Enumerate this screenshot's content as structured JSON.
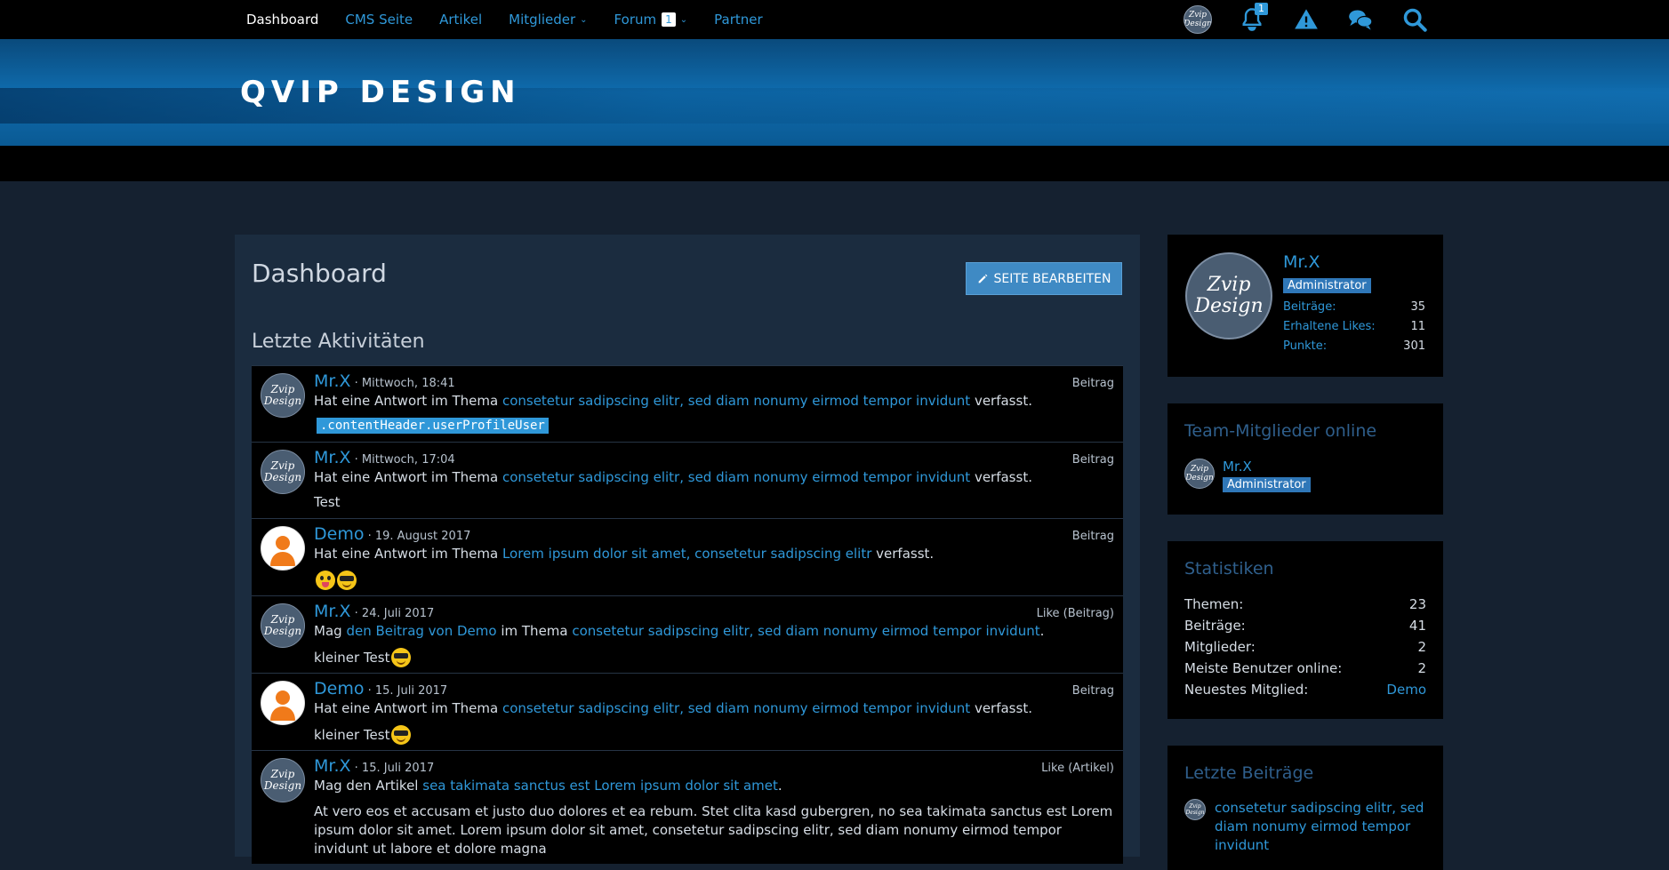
{
  "nav": {
    "items": [
      {
        "label": "Dashboard"
      },
      {
        "label": "CMS Seite"
      },
      {
        "label": "Artikel"
      },
      {
        "label": "Mitglieder"
      },
      {
        "label": "Forum",
        "badge": "1"
      },
      {
        "label": "Partner"
      }
    ],
    "notifications_count": "1"
  },
  "banner": {
    "logo": "QVIP DESIGN"
  },
  "avatar_text": "Zvip Design",
  "main": {
    "title": "Dashboard",
    "edit_button": "SEITE BEARBEITEN",
    "section_title": "Letzte Aktivitäten",
    "activities": [
      {
        "user": "Mr.X",
        "time": " · Mittwoch, 18:41",
        "type": "Beitrag",
        "desc_pre": "Hat eine Antwort im Thema ",
        "desc_link": "consetetur sadipscing elitr, sed diam nonumy eirmod tempor invidunt",
        "desc_post": " verfasst.",
        "body_code": ".contentHeader.userProfileUser"
      },
      {
        "user": "Mr.X",
        "time": " · Mittwoch, 17:04",
        "type": "Beitrag",
        "desc_pre": "Hat eine Antwort im Thema ",
        "desc_link": "consetetur sadipscing elitr, sed diam nonumy eirmod tempor invidunt",
        "desc_post": " verfasst.",
        "body": "Test"
      },
      {
        "user": "Demo",
        "time": " · 19. August 2017",
        "type": "Beitrag",
        "desc_pre": "Hat eine Antwort im Thema ",
        "desc_link": "Lorem ipsum dolor sit amet, consetetur sadipscing elitr",
        "desc_post": " verfasst."
      },
      {
        "user": "Mr.X",
        "time": " · 24. Juli 2017",
        "type": "Like (Beitrag)",
        "desc_pre": "Mag ",
        "desc_link1": "den Beitrag von Demo",
        "desc_mid": " im Thema ",
        "desc_link": "consetetur sadipscing elitr, sed diam nonumy eirmod tempor invidunt",
        "desc_post": ".",
        "body": "kleiner Test"
      },
      {
        "user": "Demo",
        "time": " · 15. Juli 2017",
        "type": "Beitrag",
        "desc_pre": "Hat eine Antwort im Thema ",
        "desc_link": "consetetur sadipscing elitr, sed diam nonumy eirmod tempor invidunt",
        "desc_post": " verfasst.",
        "body": "kleiner Test"
      },
      {
        "user": "Mr.X",
        "time": " · 15. Juli 2017",
        "type": "Like (Artikel)",
        "desc_pre": "Mag den Artikel ",
        "desc_link": "sea takimata sanctus est Lorem ipsum dolor sit amet",
        "desc_post": ".",
        "body": "At vero eos et accusam et justo duo dolores et ea rebum. Stet clita kasd gubergren, no sea takimata sanctus est Lorem ipsum dolor sit amet. Lorem ipsum dolor sit amet, consetetur sadipscing elitr, sed diam nonumy eirmod tempor invidunt ut labore et dolore magna"
      }
    ]
  },
  "sidebar": {
    "profile": {
      "name": "Mr.X",
      "role": "Administrator",
      "stats": [
        {
          "label": "Beiträge:",
          "value": "35"
        },
        {
          "label": "Erhaltene Likes:",
          "value": "11"
        },
        {
          "label": "Punkte:",
          "value": "301"
        }
      ]
    },
    "team": {
      "title": "Team-Mitglieder online",
      "member": "Mr.X",
      "role": "Administrator"
    },
    "stats": {
      "title": "Statistiken",
      "rows": [
        {
          "label": "Themen:",
          "value": "23"
        },
        {
          "label": "Beiträge:",
          "value": "41"
        },
        {
          "label": "Mitglieder:",
          "value": "2"
        },
        {
          "label": "Meiste Benutzer online:",
          "value": "2"
        },
        {
          "label": "Neuestes Mitglied:",
          "value": "Demo"
        }
      ]
    },
    "latest": {
      "title": "Letzte Beiträge",
      "post": "consetetur sadipscing elitr, sed diam nonumy eirmod tempor invidunt"
    }
  },
  "colors": {
    "accent": "#2f98d9",
    "background": "#152130",
    "panel": "#1b2c3f",
    "badge": "#2f77b8"
  }
}
